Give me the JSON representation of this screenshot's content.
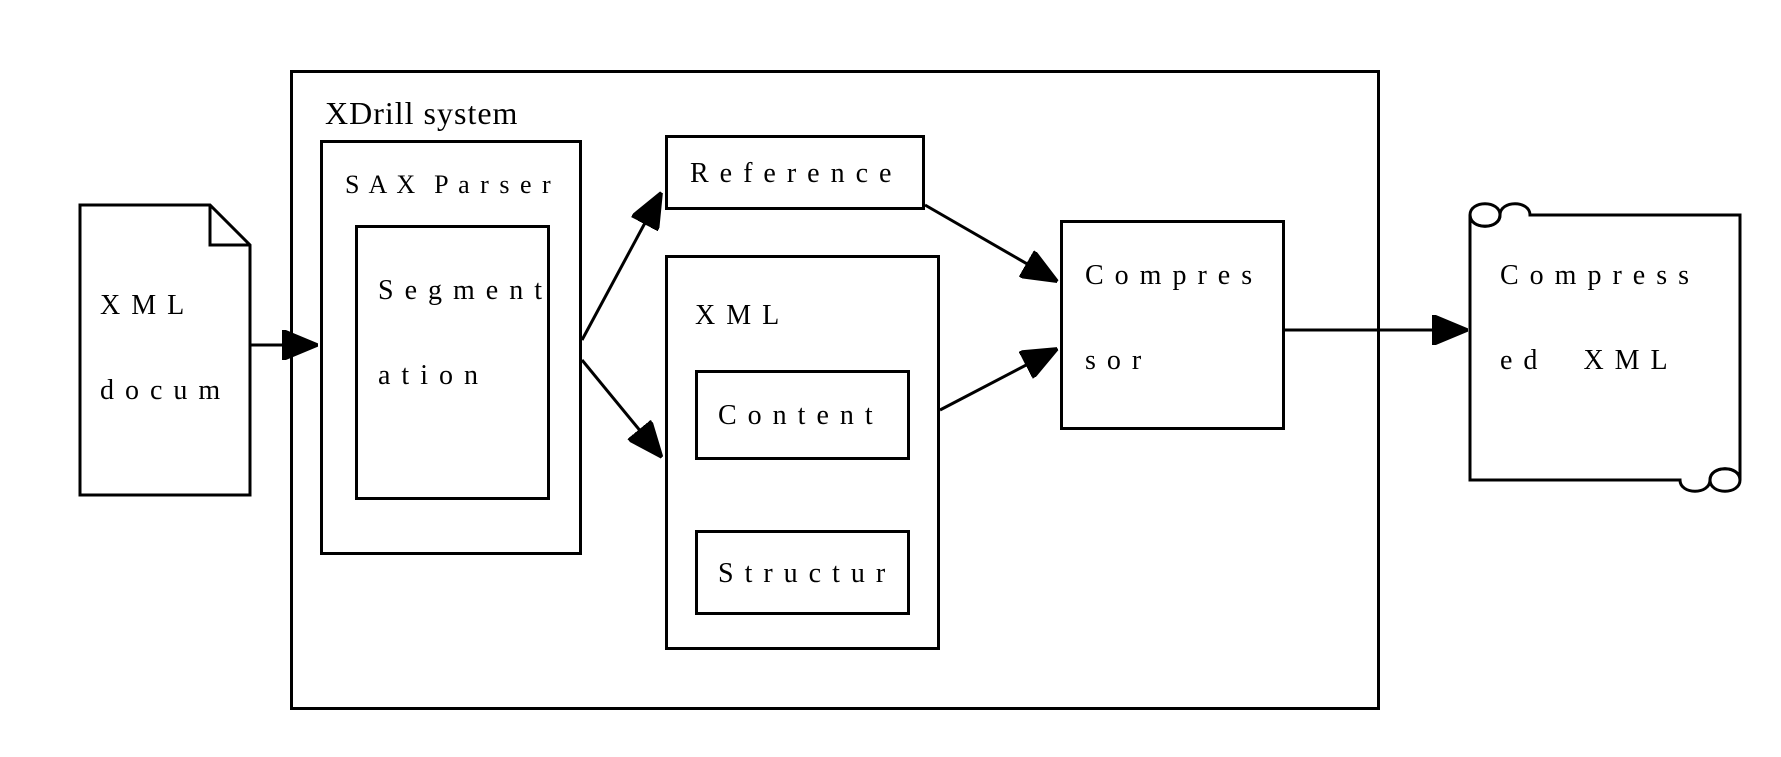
{
  "input": {
    "label_line1": "X M L",
    "label_line2": "d o c u m"
  },
  "system": {
    "title": "XDrill system",
    "parser": {
      "title": "S A X  P a r s e r",
      "seg_line1": "S e g m e n t",
      "seg_line2": "a t i o n"
    },
    "reference": "R e f e r e n c e",
    "xml_block": {
      "title": "X M L",
      "content": "C o n t e n t",
      "structure": "S t r u c t u r"
    },
    "compressor_line1": "C o m p r e s",
    "compressor_line2": "s o r"
  },
  "output": {
    "line1": "C o m p r e s s",
    "line2": "e d",
    "line3": "X M L"
  }
}
